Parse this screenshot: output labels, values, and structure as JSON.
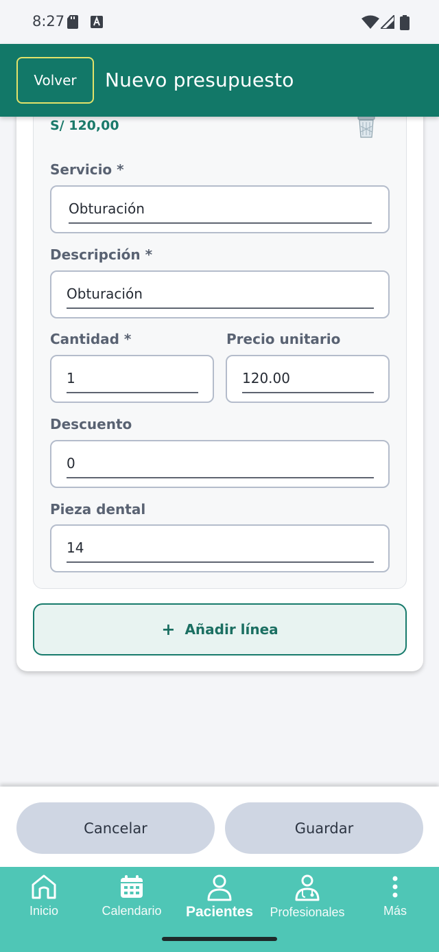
{
  "status_bar": {
    "time": "8:27"
  },
  "header": {
    "back_label": "Volver",
    "title": "Nuevo presupuesto"
  },
  "line": {
    "total": "S/ 120,00",
    "servicio": {
      "label": "Servicio *",
      "value": "Obturación"
    },
    "descripcion": {
      "label": "Descripción *",
      "value": "Obturación"
    },
    "cantidad": {
      "label": "Cantidad *",
      "value": "1"
    },
    "precio_unitario": {
      "label": "Precio unitario",
      "value": "120.00"
    },
    "descuento": {
      "label": "Descuento",
      "value": "0"
    },
    "pieza_dental": {
      "label": "Pieza dental",
      "value": "14"
    }
  },
  "add_line": {
    "icon": "+",
    "label": "Añadir línea"
  },
  "footer": {
    "cancel_label": "Cancelar",
    "save_label": "Guardar"
  },
  "nav": {
    "items": [
      {
        "label": "Inicio",
        "icon": "home-icon"
      },
      {
        "label": "Calendario",
        "icon": "calendar-icon"
      },
      {
        "label": "Pacientes",
        "icon": "person-icon",
        "active": true
      },
      {
        "label": "Profesionales",
        "icon": "doctor-icon"
      },
      {
        "label": "Más",
        "icon": "more-vertical-icon"
      }
    ]
  },
  "colors": {
    "primary": "#127868",
    "nav": "#4fc6b6",
    "accent_text": "#1b7a6b"
  }
}
